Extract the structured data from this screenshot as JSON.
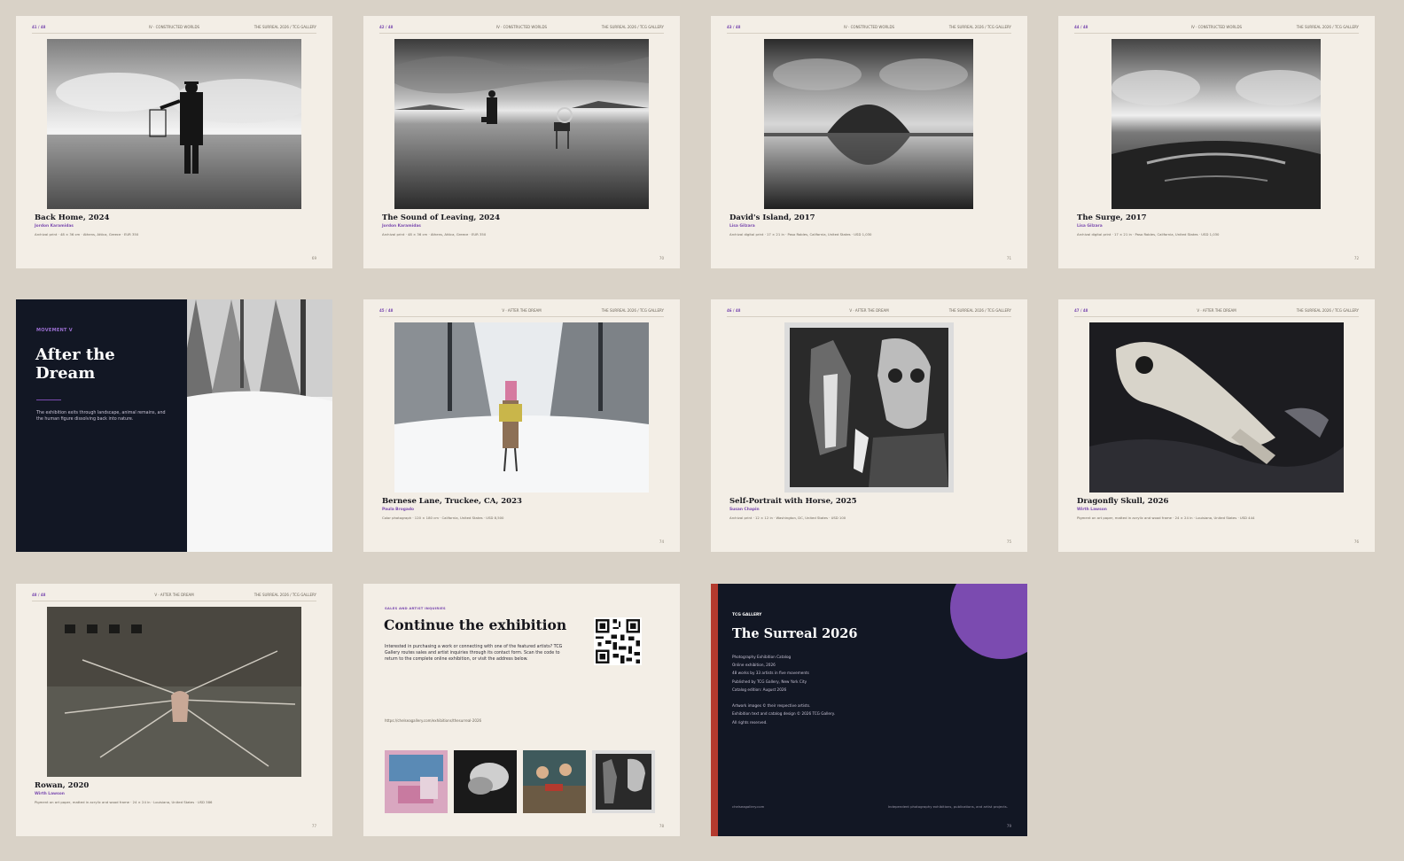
{
  "pages": [
    {
      "num": "41 / 48",
      "section": "IV · CONSTRUCTED WORLDS",
      "brand": "THE SURREAL 2026 / TCG GALLERY",
      "title": "Back Home, 2024",
      "artist": "Jordon Karamidas",
      "meta": "Archival print · 48 × 36 cm · Athens, Attica, Greece · EUR 350",
      "page": "69"
    },
    {
      "num": "42 / 48",
      "section": "IV · CONSTRUCTED WORLDS",
      "brand": "THE SURREAL 2026 / TCG GALLERY",
      "title": "The Sound of Leaving, 2024",
      "artist": "Jordon Karamidas",
      "meta": "Archival print · 48 × 36 cm · Athens, Attica, Greece · EUR 350",
      "page": "70"
    },
    {
      "num": "43 / 48",
      "section": "IV · CONSTRUCTED WORLDS",
      "brand": "THE SURREAL 2026 / TCG GALLERY",
      "title": "David's Island, 2017",
      "artist": "Lisa Gilzara",
      "meta": "Archival digital print · 17 × 21 in · Paso Robles, California, United States · USD 1,030",
      "page": "71"
    },
    {
      "num": "44 / 48",
      "section": "IV · CONSTRUCTED WORLDS",
      "brand": "THE SURREAL 2026 / TCG GALLERY",
      "title": "The Surge, 2017",
      "artist": "Lisa Gilzara",
      "meta": "Archival digital print · 17 × 21 in · Paso Robles, California, United States · USD 1,030",
      "page": "72"
    },
    {
      "num": "45 / 48",
      "section": "V · AFTER THE DREAM",
      "brand": "THE SURREAL 2026 / TCG GALLERY",
      "title": "Bernese Lane, Truckee, CA, 2023",
      "artist": "Paula Brogado",
      "meta": "Color photograph · 120 × 180 cm · California, United States · USD 8,500",
      "page": "74"
    },
    {
      "num": "46 / 48",
      "section": "V · AFTER THE DREAM",
      "brand": "THE SURREAL 2026 / TCG GALLERY",
      "title": "Self-Portrait with Horse, 2025",
      "artist": "Susan Chapin",
      "meta": "Archival print · 12 × 12 in · Washington, DC, United States · USD 100",
      "page": "75"
    },
    {
      "num": "47 / 48",
      "section": "V · AFTER THE DREAM",
      "brand": "THE SURREAL 2026 / TCG GALLERY",
      "title": "Dragonfly Skull, 2026",
      "artist": "Wirth Lawson",
      "meta": "Pigment on art paper, matted in acrylic and wood frame · 24 × 24 in · Louisiana, United States · USD 444",
      "page": "76"
    },
    {
      "num": "48 / 48",
      "section": "V · AFTER THE DREAM",
      "brand": "THE SURREAL 2026 / TCG GALLERY",
      "title": "Rowan, 2020",
      "artist": "Wirth Lawson",
      "meta": "Pigment on art paper, matted in acrylic and wood frame · 24 × 24 in · Louisiana, United States · USD 386",
      "page": "77"
    }
  ],
  "movement": {
    "label": "MOVEMENT V",
    "title": "After the Dream",
    "description": "The exhibition exits through landscape, animal remains, and the human figure dissolving back into nature."
  },
  "contact": {
    "label": "SALES AND ARTIST INQUIRIES",
    "title": "Continue the exhibition",
    "body": "Interested in purchasing a work or connecting with one of the featured artists? TCG Gallery routes sales and artist inquiries through its contact form. Scan the code to return to the complete online exhibition, or visit the address below.",
    "url": "https://chelseagallery.com/exhibitions/thesurreal-2026",
    "page": "78"
  },
  "colophon": {
    "label": "TCG GALLERY",
    "title": "The Surreal 2026",
    "lines": [
      "Photography Exhibition Catalog",
      "Online exhibition, 2026",
      "48 works by 33 artists in five movements",
      "Published by TCG Gallery, New York City",
      "Catalog edition: August 2026",
      "",
      "Artwork images © their respective artists.",
      "Exhibition text and catalog design © 2026 TCG Gallery.",
      "All rights reserved."
    ],
    "footer_left": "chelseagallery.com",
    "footer_right": "Independent photography exhibitions, publications, and artist projects.",
    "page": "79"
  },
  "colors": {
    "accent": "#7b4bb0",
    "navy": "#121724",
    "paper": "#f3eee6",
    "red": "#b33a2e"
  }
}
